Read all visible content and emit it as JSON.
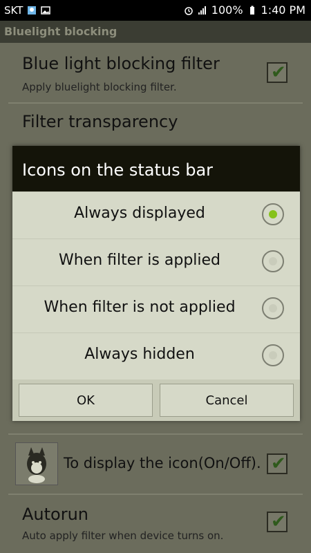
{
  "status_bar": {
    "carrier": "SKT",
    "battery": "100%",
    "time": "1:40 PM"
  },
  "app_title": "Bluelight blocking",
  "settings": {
    "blue_filter_title": "Blue light blocking filter",
    "blue_filter_sub": "Apply bluelight blocking filter.",
    "transparency_title": "Filter transparency",
    "display_icon_label": "To display the icon(On/Off).",
    "autorun_title": "Autorun",
    "autorun_sub": "Auto apply filter when device turns on."
  },
  "dialog": {
    "title": "Icons on the status bar",
    "options": [
      "Always displayed",
      "When filter is applied",
      "When filter is not applied",
      "Always hidden"
    ],
    "selected_index": 0,
    "ok": "OK",
    "cancel": "Cancel"
  },
  "colors": {
    "accent_green": "#86c21a",
    "dialog_header": "#141409"
  }
}
